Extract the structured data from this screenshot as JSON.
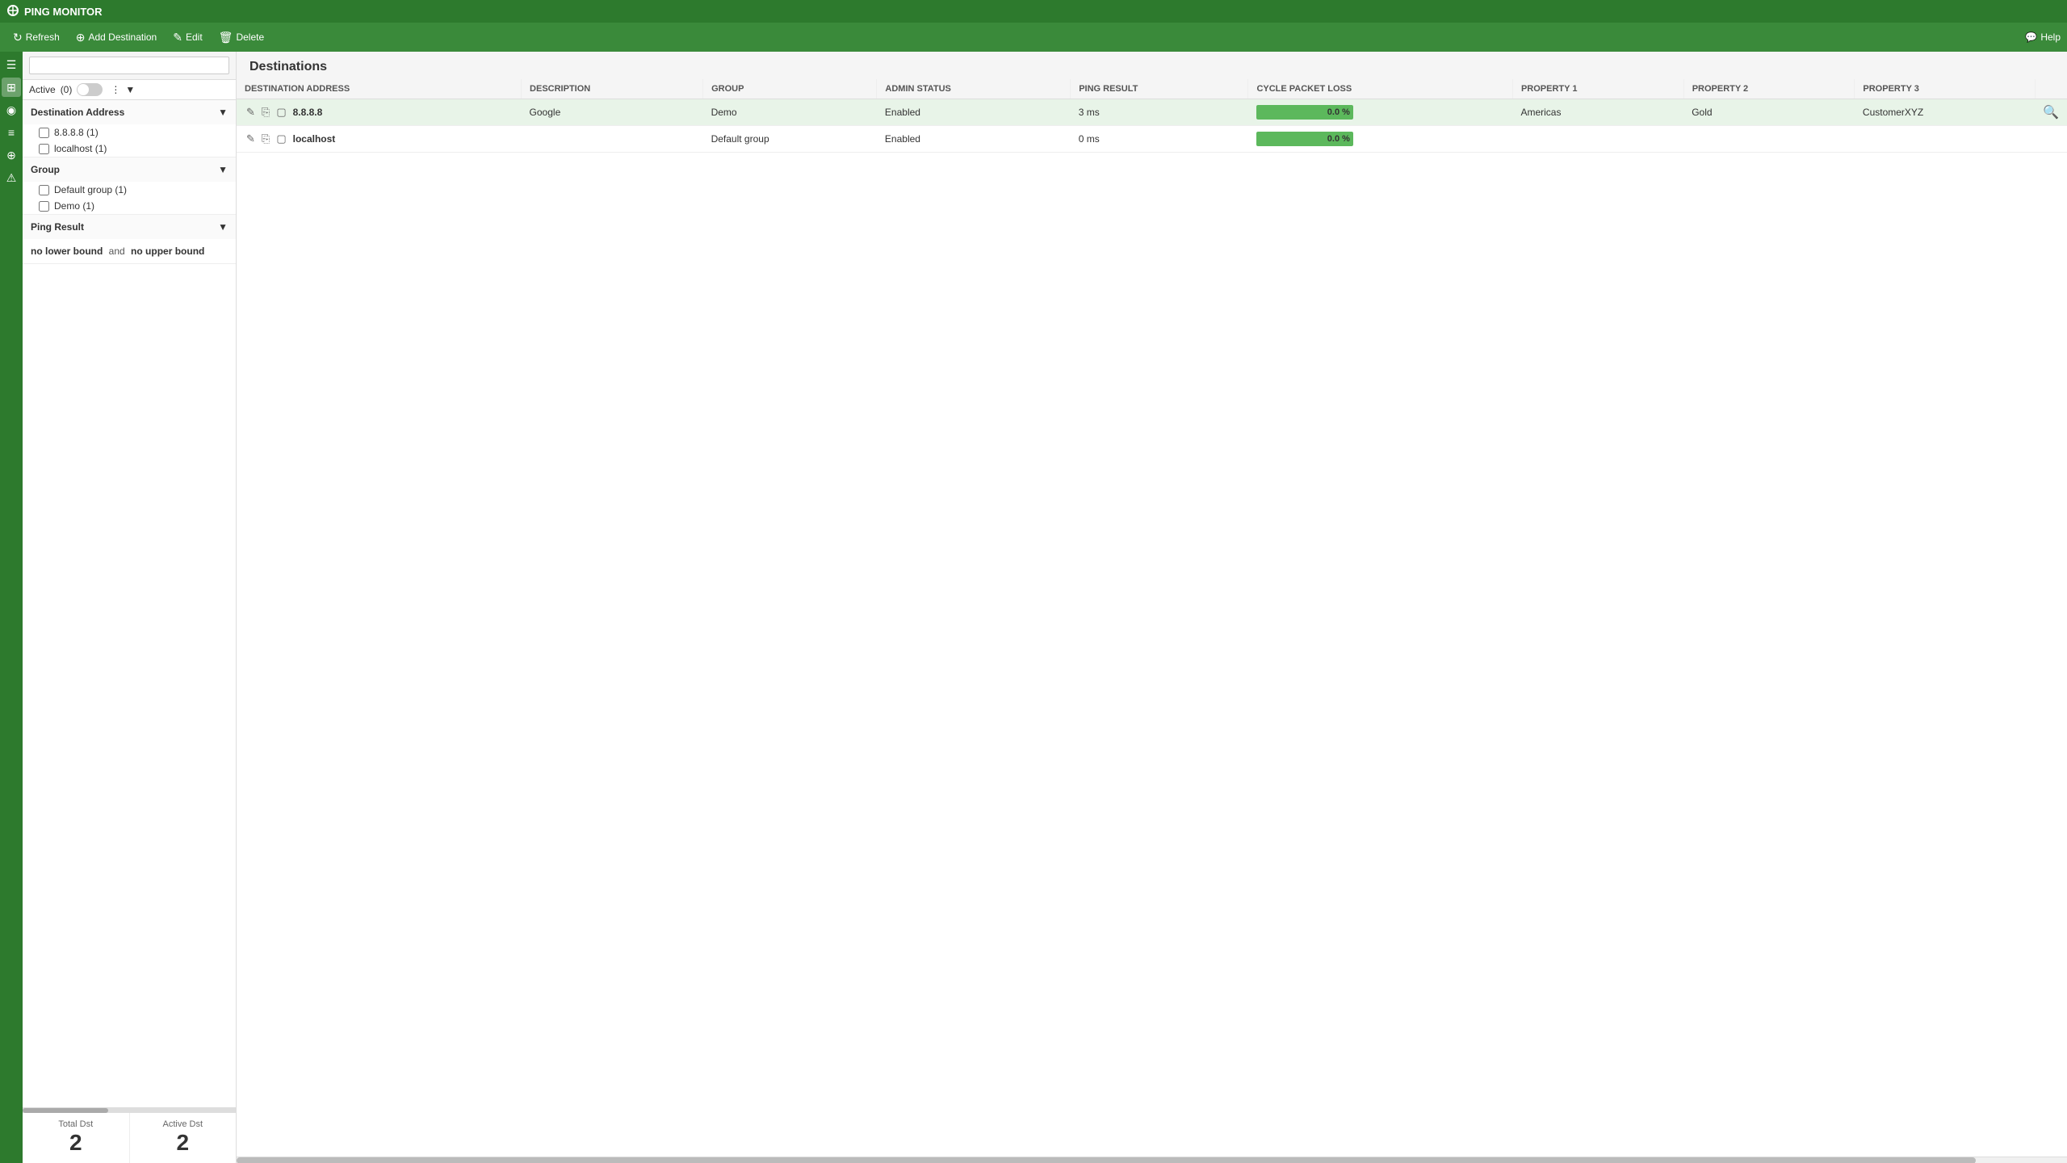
{
  "app": {
    "title": "PING MONITOR"
  },
  "toolbar": {
    "refresh_label": "Refresh",
    "add_destination_label": "Add Destination",
    "edit_label": "Edit",
    "delete_label": "Delete",
    "help_label": "Help"
  },
  "sidebar_icons": [
    {
      "name": "menu-icon",
      "symbol": "☰"
    },
    {
      "name": "home-icon",
      "symbol": "⊞"
    },
    {
      "name": "monitor-icon",
      "symbol": "◉"
    },
    {
      "name": "chart-icon",
      "symbol": "≡"
    },
    {
      "name": "network-icon",
      "symbol": "⊕"
    },
    {
      "name": "settings-icon",
      "symbol": "⚙"
    }
  ],
  "filter": {
    "active_label": "Active",
    "active_count": "(0)",
    "destination_address_label": "Destination Address",
    "destination_items": [
      {
        "label": "8.8.8.8",
        "count": "(1)",
        "checked": false
      },
      {
        "label": "localhost",
        "count": "(1)",
        "checked": false
      }
    ],
    "group_label": "Group",
    "group_items": [
      {
        "label": "Default group",
        "count": "(1)",
        "checked": false
      },
      {
        "label": "Demo",
        "count": "(1)",
        "checked": false
      }
    ],
    "ping_result_label": "Ping Result",
    "ping_result_lower": "no lower bound",
    "ping_result_and": "and",
    "ping_result_upper": "no upper bound"
  },
  "stats": {
    "total_dst_label": "Total Dst",
    "total_dst_value": "2",
    "active_dst_label": "Active Dst",
    "active_dst_value": "2"
  },
  "table": {
    "title": "Destinations",
    "columns": [
      "DESTINATION ADDRESS",
      "DESCRIPTION",
      "GROUP",
      "ADMIN STATUS",
      "PING RESULT",
      "CYCLE PACKET LOSS",
      "PROPERTY 1",
      "PROPERTY 2",
      "PROPERTY 3"
    ],
    "rows": [
      {
        "address": "8.8.8.8",
        "description": "Google",
        "group": "Demo",
        "admin_status": "Enabled",
        "ping_result": "3 ms",
        "cycle_packet_loss_pct": 100,
        "cycle_packet_loss_text": "0.0 %",
        "property1": "Americas",
        "property2": "Gold",
        "property3": "CustomerXYZ",
        "selected": true
      },
      {
        "address": "localhost",
        "description": "",
        "group": "Default group",
        "admin_status": "Enabled",
        "ping_result": "0 ms",
        "cycle_packet_loss_pct": 100,
        "cycle_packet_loss_text": "0.0 %",
        "property1": "",
        "property2": "",
        "property3": "",
        "selected": false
      }
    ]
  }
}
